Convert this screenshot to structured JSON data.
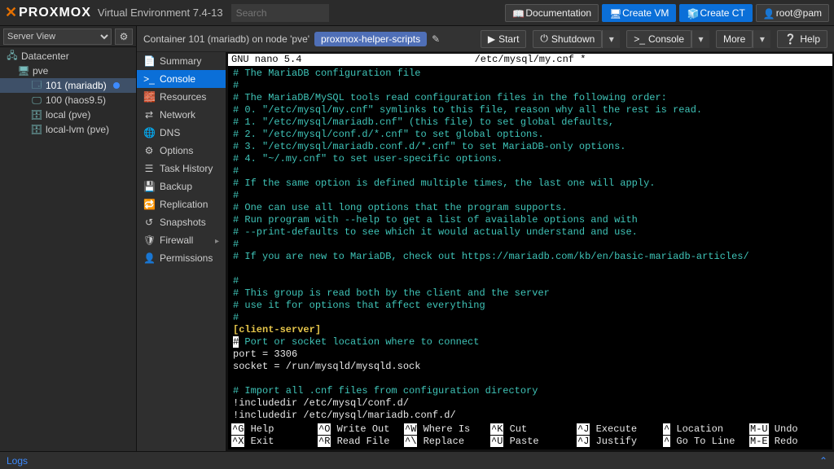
{
  "header": {
    "brand": "PROXMOX",
    "title": "Virtual Environment 7.4-13",
    "search_placeholder": "Search",
    "buttons": {
      "doc": "Documentation",
      "create_vm": "Create VM",
      "create_ct": "Create CT",
      "user": "root@pam"
    }
  },
  "sidebar": {
    "view_label": "Server View",
    "tree": [
      {
        "label": "Datacenter",
        "icon": "🖧",
        "ind": 0
      },
      {
        "label": "pve",
        "icon": "🖥",
        "ind": 1
      },
      {
        "label": "101 (mariadb)",
        "icon": "🗔",
        "ind": 2,
        "selected": true,
        "dot": true
      },
      {
        "label": "100 (haos9.5)",
        "icon": "🖵",
        "ind": 2
      },
      {
        "label": "local (pve)",
        "icon": "🗄",
        "ind": 2
      },
      {
        "label": "local-lvm (pve)",
        "icon": "🗄",
        "ind": 2
      }
    ]
  },
  "crumb": {
    "text": "Container 101 (mariadb) on node 'pve'",
    "tag": "proxmox-helper-scripts"
  },
  "actions": {
    "start": "Start",
    "shutdown": "Shutdown",
    "console": "Console",
    "more": "More",
    "help": "Help"
  },
  "nav": [
    {
      "label": "Summary",
      "icon": "📄"
    },
    {
      "label": "Console",
      "icon": ">_",
      "selected": true
    },
    {
      "label": "Resources",
      "icon": "🧱"
    },
    {
      "label": "Network",
      "icon": "⇄"
    },
    {
      "label": "DNS",
      "icon": "🌐"
    },
    {
      "label": "Options",
      "icon": "⚙"
    },
    {
      "label": "Task History",
      "icon": "☰"
    },
    {
      "label": "Backup",
      "icon": "💾"
    },
    {
      "label": "Replication",
      "icon": "🔁"
    },
    {
      "label": "Snapshots",
      "icon": "↺"
    },
    {
      "label": "Firewall",
      "icon": "🛡",
      "arrow": true
    },
    {
      "label": "Permissions",
      "icon": "👤"
    }
  ],
  "nano": {
    "top_left": "  GNU nano 5.4",
    "top_center": "/etc/mysql/my.cnf *",
    "body": [
      {
        "c": "cyan",
        "t": "# The MariaDB configuration file"
      },
      {
        "c": "cyan",
        "t": "#"
      },
      {
        "c": "cyan",
        "t": "# The MariaDB/MySQL tools read configuration files in the following order:"
      },
      {
        "c": "cyan",
        "t": "# 0. \"/etc/mysql/my.cnf\" symlinks to this file, reason why all the rest is read."
      },
      {
        "c": "cyan",
        "t": "# 1. \"/etc/mysql/mariadb.cnf\" (this file) to set global defaults,"
      },
      {
        "c": "cyan",
        "t": "# 2. \"/etc/mysql/conf.d/*.cnf\" to set global options."
      },
      {
        "c": "cyan",
        "t": "# 3. \"/etc/mysql/mariadb.conf.d/*.cnf\" to set MariaDB-only options."
      },
      {
        "c": "cyan",
        "t": "# 4. \"~/.my.cnf\" to set user-specific options."
      },
      {
        "c": "cyan",
        "t": "#"
      },
      {
        "c": "cyan",
        "t": "# If the same option is defined multiple times, the last one will apply."
      },
      {
        "c": "cyan",
        "t": "#"
      },
      {
        "c": "cyan",
        "t": "# One can use all long options that the program supports."
      },
      {
        "c": "cyan",
        "t": "# Run program with --help to get a list of available options and with"
      },
      {
        "c": "cyan",
        "t": "# --print-defaults to see which it would actually understand and use."
      },
      {
        "c": "cyan",
        "t": "#"
      },
      {
        "c": "cyan",
        "t": "# If you are new to MariaDB, check out https://mariadb.com/kb/en/basic-mariadb-articles/"
      },
      {
        "c": "cyan",
        "t": ""
      },
      {
        "c": "cyan",
        "t": "#"
      },
      {
        "c": "cyan",
        "t": "# This group is read both by the client and the server"
      },
      {
        "c": "cyan",
        "t": "# use it for options that affect everything"
      },
      {
        "c": "cyan",
        "t": "#"
      },
      {
        "c": "yellow",
        "t": "[client-server]"
      },
      {
        "c": "mixed",
        "pre": "#",
        "t": " Port or socket location where to connect"
      },
      {
        "c": "white",
        "t": "port = 3306"
      },
      {
        "c": "white",
        "t": "socket = /run/mysqld/mysqld.sock"
      },
      {
        "c": "white",
        "t": ""
      },
      {
        "c": "cyan",
        "t": "# Import all .cnf files from configuration directory"
      },
      {
        "c": "white",
        "t": "!includedir /etc/mysql/conf.d/"
      },
      {
        "c": "white",
        "t": "!includedir /etc/mysql/mariadb.conf.d/"
      }
    ],
    "foot": [
      [
        [
          "^G",
          "Help"
        ],
        [
          "^X",
          "Exit"
        ]
      ],
      [
        [
          "^O",
          "Write Out"
        ],
        [
          "^R",
          "Read File"
        ]
      ],
      [
        [
          "^W",
          "Where Is"
        ],
        [
          "^\\",
          "Replace"
        ]
      ],
      [
        [
          "^K",
          "Cut"
        ],
        [
          "^U",
          "Paste"
        ]
      ],
      [
        [
          "^J",
          "Execute"
        ],
        [
          "^J",
          "Justify"
        ]
      ],
      [
        [
          "^",
          "Location"
        ],
        [
          "^",
          "Go To Line"
        ]
      ],
      [
        [
          "M-U",
          "Undo"
        ],
        [
          "M-E",
          "Redo"
        ]
      ]
    ]
  },
  "logs": {
    "label": "Logs"
  }
}
